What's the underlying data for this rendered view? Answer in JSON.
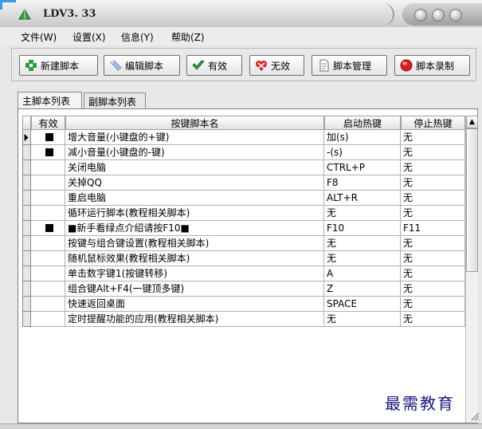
{
  "window": {
    "title": "LDV3. 33"
  },
  "menu": [
    {
      "label": "文件(W)"
    },
    {
      "label": "设置(X)"
    },
    {
      "label": "信息(Y)"
    },
    {
      "label": "帮助(Z)"
    }
  ],
  "toolbar": [
    {
      "label": "新建脚本",
      "icon": "plus-icon"
    },
    {
      "label": "编辑脚本",
      "icon": "pencil-icon"
    },
    {
      "label": "有效",
      "icon": "check-icon"
    },
    {
      "label": "无效",
      "icon": "invalid-icon"
    },
    {
      "label": "脚本管理",
      "icon": "document-icon"
    },
    {
      "label": "脚本录制",
      "icon": "record-icon"
    }
  ],
  "tabs": [
    {
      "label": "主脚本列表",
      "active": true
    },
    {
      "label": "副脚本列表",
      "active": false
    }
  ],
  "table": {
    "columns": [
      "有效",
      "按键脚本名",
      "启动热键",
      "停止热键"
    ],
    "rows": [
      {
        "valid": true,
        "name": "增大音量(小键盘的+键)",
        "start": "加(s)",
        "stop": "无",
        "current": true
      },
      {
        "valid": true,
        "name": "减小音量(小键盘的-键)",
        "start": "-(s)",
        "stop": "无"
      },
      {
        "valid": false,
        "name": "关闭电脑",
        "start": "CTRL+P",
        "stop": "无"
      },
      {
        "valid": false,
        "name": "关掉QQ",
        "start": "F8",
        "stop": "无"
      },
      {
        "valid": false,
        "name": "重启电脑",
        "start": "ALT+R",
        "stop": "无"
      },
      {
        "valid": false,
        "name": "循环运行脚本(教程相关脚本)",
        "start": "无",
        "stop": "无"
      },
      {
        "valid": true,
        "name": "■新手看绿点介绍请按F10■",
        "start": "F10",
        "stop": "F11"
      },
      {
        "valid": false,
        "name": "按键与组合键设置(教程相关脚本)",
        "start": "无",
        "stop": "无"
      },
      {
        "valid": false,
        "name": "随机鼠标效果(教程相关脚本)",
        "start": "无",
        "stop": "无"
      },
      {
        "valid": false,
        "name": "单击数字键1(按键转移)",
        "start": "A",
        "stop": "无"
      },
      {
        "valid": false,
        "name": "组合键Alt+F4(一键顶多键)",
        "start": "Z",
        "stop": "无"
      },
      {
        "valid": false,
        "name": "快速返回桌面",
        "start": "SPACE",
        "stop": "无"
      },
      {
        "valid": false,
        "name": "定时提醒功能的应用(教程相关脚本)",
        "start": "无",
        "stop": "无"
      }
    ]
  },
  "watermark": "最需教育"
}
